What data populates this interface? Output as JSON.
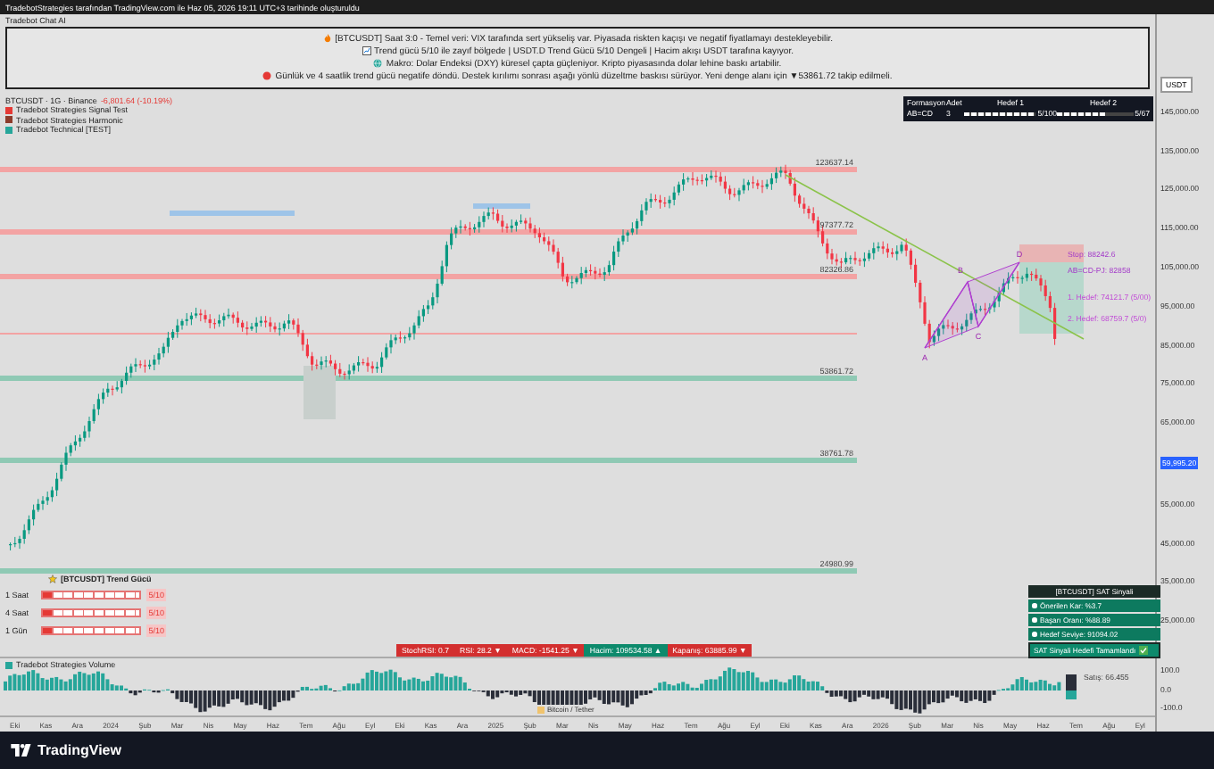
{
  "header": {
    "caption": "TradebotStrategies tarafından TradingView.com ile Haz 05, 2026 19:11 UTC+3 tarihinde oluşturuldu"
  },
  "chat": {
    "title": "Tradebot Chat AI",
    "lines": [
      {
        "kind": "fire",
        "text": "[BTCUSDT] Saat 3:0 - Temel veri: VIX tarafında sert yükseliş var. Piyasada riskten kaçışı ve negatif fiyatlamayı destekleyebilir."
      },
      {
        "kind": "chart",
        "text": "Trend gücü 5/10 ile zayıf bölgede | USDT.D Trend Gücü 5/10 Dengeli | Hacim akışı USDT tarafına kayıyor."
      },
      {
        "kind": "macro",
        "text": "Makro: Dolar Endeksi (DXY) küresel çapta güçleniyor. Kripto piyasasında dolar lehine baskı artabilir."
      },
      {
        "kind": "alert",
        "text": "Günlük ve 4 saatlik trend gücü negatife döndü. Destek kırılımı sonrası aşağı yönlü düzeltme baskısı sürüyor. Yeni denge alanı için ▼53861.72 takip edilmeli."
      }
    ]
  },
  "legend": {
    "symbol": "BTCUSDT · 1G · Binance",
    "change": "-6,801.64 (-10.19%)",
    "indicators": [
      {
        "name": "Tradebot Strategies Signal Test",
        "color": "#e53935"
      },
      {
        "name": "Tradebot Strategies Harmonic",
        "color": "#8d3b2b"
      },
      {
        "name": "Tradebot Technical [TEST]",
        "color": "#26a69a"
      }
    ]
  },
  "pattern_table": {
    "columns": [
      "Formasyon",
      "Adet",
      "Hedef 1",
      "Hedef 2"
    ],
    "rows": [
      {
        "pattern": "AB=CD",
        "count": "3",
        "targets": [
          {
            "level": 1,
            "reading": "5/100"
          },
          {
            "level": 0.65,
            "reading": "5/67"
          }
        ]
      }
    ]
  },
  "price_levels": [
    {
      "label": "123637.14",
      "kind": "resistance"
    },
    {
      "label": "97377.72",
      "kind": "resistance"
    },
    {
      "label": "82326.86",
      "kind": "resistance"
    },
    {
      "label": "53861.72",
      "kind": "support"
    },
    {
      "label": "38761.78",
      "kind": "support"
    },
    {
      "label": "24980.99",
      "kind": "support"
    }
  ],
  "harmonic": {
    "points": [
      "A",
      "B",
      "C",
      "D"
    ],
    "annotations": [
      {
        "kind": "stop",
        "text": "Stop: 88242.6"
      },
      {
        "kind": "entry",
        "text": "AB=CD-PJ: 82858"
      },
      {
        "kind": "target",
        "text": "1. Hedef: 74121.7 (5/00)"
      },
      {
        "kind": "target",
        "text": "2. Hedef: 68759.7 (5/0)"
      }
    ]
  },
  "trend_panel": {
    "title": "[BTCUSDT] Trend Gücü",
    "rows": [
      {
        "label": "1 Saat",
        "level": 0.1,
        "reading": "5/10"
      },
      {
        "label": "4 Saat",
        "level": 0.1,
        "reading": "5/10"
      },
      {
        "label": "1 Gün",
        "level": 0.1,
        "reading": "5/10"
      }
    ]
  },
  "indicator_bar": [
    {
      "text": "StochRSI: 0.7",
      "bearish": true
    },
    {
      "text": "RSI: 28.2 ▼",
      "bearish": true
    },
    {
      "text": "MACD: -1541.25 ▼",
      "bearish": true
    },
    {
      "text": "Hacim: 109534.58 ▲",
      "bearish": false
    },
    {
      "text": "Kapanış: 63885.99 ▼",
      "bearish": true
    }
  ],
  "signal_panel": {
    "title": "[BTCUSDT] SAT Sinyali",
    "rows": [
      "Önerilen Kar: %3.7",
      "Başarı Oranı: %88.89",
      "Hedef Seviye: 91094.02"
    ],
    "status": {
      "text": "SAT Sinyali Hedefi Tamamlandı",
      "completed": true
    }
  },
  "price_axis": {
    "currency": "USDT",
    "ticks": [
      {
        "label": "145,000.00",
        "current": false
      },
      {
        "label": "135,000.00",
        "current": false
      },
      {
        "label": "125,000.00",
        "current": false
      },
      {
        "label": "115,000.00",
        "current": false
      },
      {
        "label": "105,000.00",
        "current": false
      },
      {
        "label": "95,000.00",
        "current": false
      },
      {
        "label": "85,000.00",
        "current": false
      },
      {
        "label": "75,000.00",
        "current": false
      },
      {
        "label": "65,000.00",
        "current": false
      },
      {
        "label": "59,995.20",
        "current": true
      },
      {
        "label": "55,000.00",
        "current": false
      },
      {
        "label": "45,000.00",
        "current": false
      },
      {
        "label": "35,000.00",
        "current": false
      },
      {
        "label": "25,000.00",
        "current": false
      }
    ]
  },
  "volume_pane": {
    "title": "Tradebot Strategies Volume",
    "reading": "Satış: 66.455",
    "pair": "Bitcoin / Tether",
    "ticks": [
      "100.0",
      "0.0",
      "-100.0"
    ]
  },
  "time_axis": [
    "Eki",
    "Kas",
    "Ara",
    "2024",
    "Şub",
    "Mar",
    "Nis",
    "May",
    "Haz",
    "Tem",
    "Ağu",
    "Eyl",
    "Eki",
    "Kas",
    "Ara",
    "2025",
    "Şub",
    "Mar",
    "Nis",
    "May",
    "Haz",
    "Tem",
    "Ağu",
    "Eyl",
    "Eki",
    "Kas",
    "Ara",
    "2026",
    "Şub",
    "Mar",
    "Nis",
    "May",
    "Haz",
    "Tem",
    "Ağu",
    "Eyl"
  ],
  "footer": {
    "brand": "TradingView"
  }
}
